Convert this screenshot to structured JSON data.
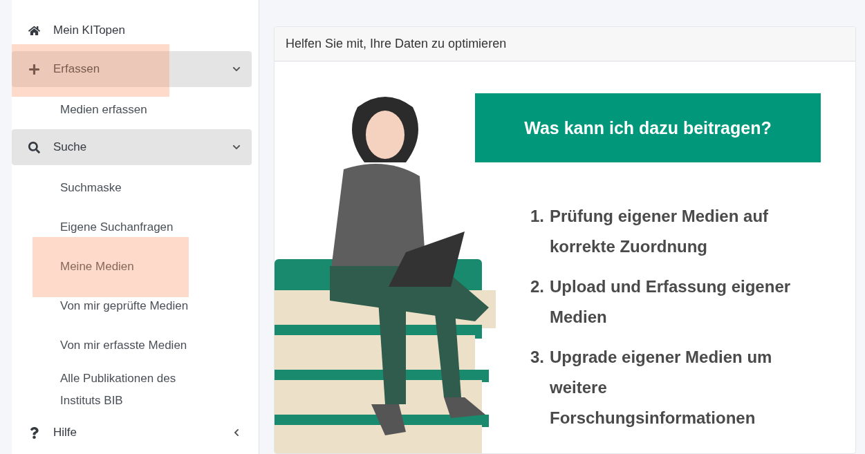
{
  "sidebar": {
    "items": [
      {
        "kind": "link",
        "label": "Mein KITopen",
        "highlighted": false
      },
      {
        "kind": "group",
        "label": "Erfassen",
        "expanded": true,
        "highlighted": true,
        "children": [
          {
            "label": "Medien erfassen",
            "highlighted": false
          }
        ]
      },
      {
        "kind": "group",
        "label": "Suche",
        "expanded": true,
        "highlighted": false,
        "children": [
          {
            "label": "Suchmaske",
            "highlighted": false
          },
          {
            "label": "Eigene Suchanfragen",
            "highlighted": false
          },
          {
            "label": "Meine Medien",
            "highlighted": true
          },
          {
            "label": "Von mir geprüfte Medien",
            "highlighted": false
          },
          {
            "label": "Von mir erfasste Medien",
            "highlighted": false
          },
          {
            "label": "Alle Publikationen des Instituts BIB",
            "highlighted": false
          }
        ]
      },
      {
        "kind": "group",
        "label": "Hilfe",
        "expanded": false,
        "highlighted": false
      }
    ]
  },
  "card": {
    "title": "Helfen Sie mit, Ihre Daten zu optimieren",
    "bubble": "Was kann ich dazu beitragen?",
    "steps": [
      {
        "number": "1.",
        "text": "Prüfung eigener Medien auf korrekte Zuordnung"
      },
      {
        "number": "2.",
        "text": "Upload und Erfassung eigener Medien"
      },
      {
        "number": "3.",
        "text": "Upgrade eigener Medien um weitere Forschungsinformationen"
      }
    ]
  }
}
